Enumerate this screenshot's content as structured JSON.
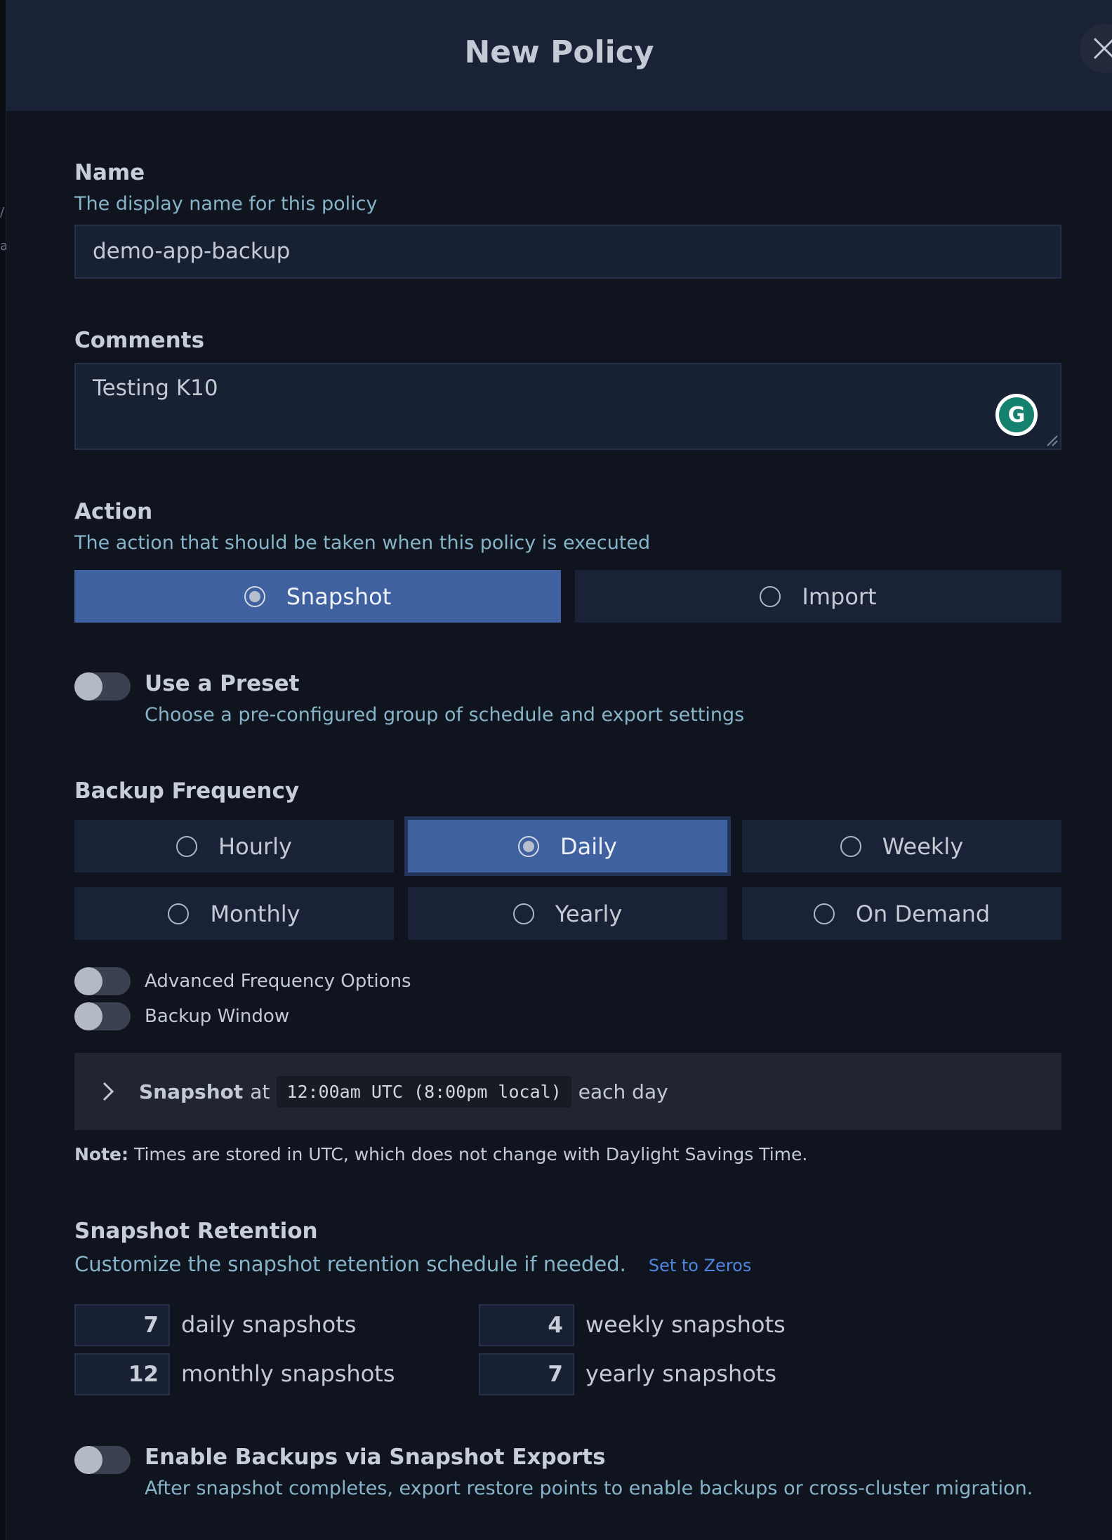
{
  "dialog": {
    "title": "New Policy"
  },
  "name_field": {
    "label": "Name",
    "hint": "The display name for this policy",
    "value": "demo-app-backup"
  },
  "comments_field": {
    "label": "Comments",
    "value": "Testing K10",
    "grammarly_glyph": "G"
  },
  "action": {
    "label": "Action",
    "hint": "The action that should be taken when this policy is executed",
    "options": [
      "Snapshot",
      "Import"
    ],
    "selected": "Snapshot"
  },
  "preset": {
    "label": "Use a Preset",
    "hint": "Choose a pre-configured group of schedule and export settings",
    "enabled": false
  },
  "frequency": {
    "label": "Backup Frequency",
    "options": [
      "Hourly",
      "Daily",
      "Weekly",
      "Monthly",
      "Yearly",
      "On Demand"
    ],
    "selected": "Daily"
  },
  "advanced_frequency": {
    "label": "Advanced Frequency Options",
    "enabled": false
  },
  "backup_window": {
    "label": "Backup Window",
    "enabled": false
  },
  "schedule_summary": {
    "action": "Snapshot",
    "at": "at",
    "time": "12:00am UTC (8:00pm local)",
    "suffix": "each day"
  },
  "note": {
    "prefix": "Note:",
    "text": "Times are stored in UTC, which does not change with Daylight Savings Time."
  },
  "retention": {
    "label": "Snapshot Retention",
    "hint": "Customize the snapshot retention schedule if needed.",
    "reset_link": "Set to Zeros",
    "daily": {
      "value": "7",
      "label": "daily snapshots"
    },
    "weekly": {
      "value": "4",
      "label": "weekly snapshots"
    },
    "monthly": {
      "value": "12",
      "label": "monthly snapshots"
    },
    "yearly": {
      "value": "7",
      "label": "yearly snapshots"
    }
  },
  "exports": {
    "label": "Enable Backups via Snapshot Exports",
    "hint": "After snapshot completes, export restore points to enable backups or cross-cluster migration.",
    "enabled": false
  },
  "colors": {
    "background": "#10141f",
    "header": "#1a2238",
    "selected_option": "#3f61a0",
    "hint_text": "#86b4c9",
    "link": "#4f86df"
  }
}
